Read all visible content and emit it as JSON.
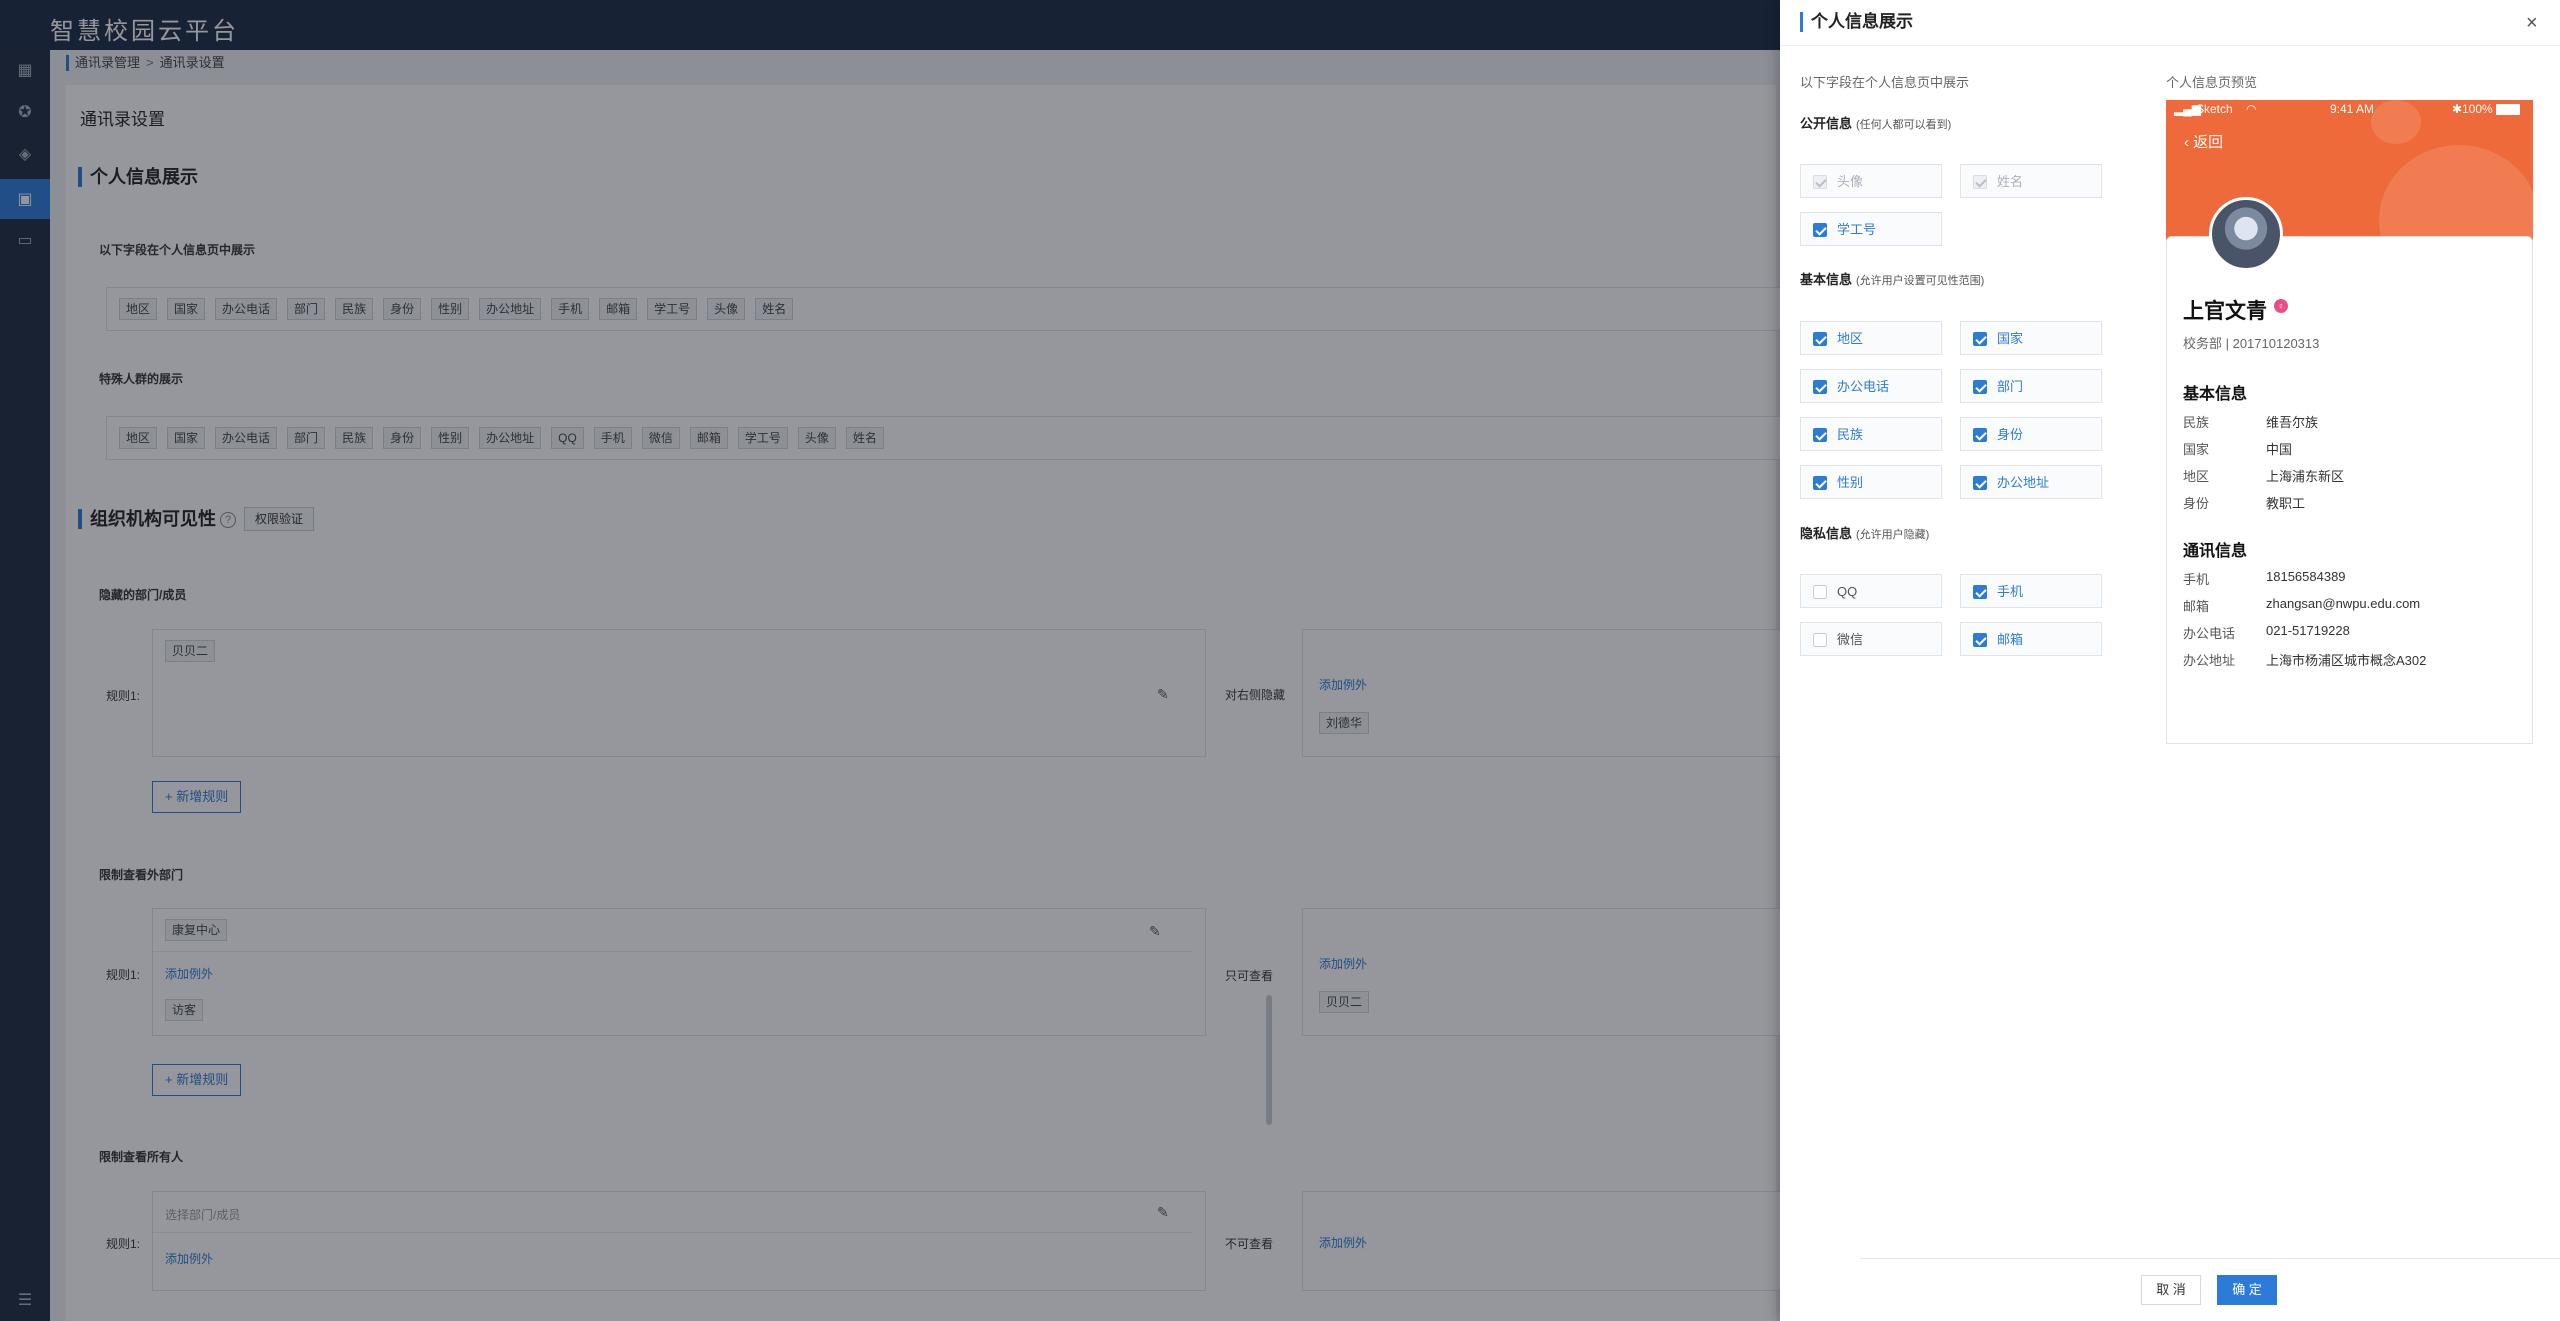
{
  "app": {
    "title": "智慧校园云平台"
  },
  "nav": {
    "icons": [
      "grid-icon",
      "star-icon",
      "layers-icon",
      "apps-icon",
      "message-icon"
    ],
    "bottom_icon": "menu-icon"
  },
  "breadcrumb": {
    "items": [
      "通讯录管理",
      "通讯录设置"
    ],
    "separator": ">"
  },
  "page": {
    "title": "通讯录设置",
    "section_profile": "个人信息展示",
    "profile_sub": "以下字段在个人信息页中展示",
    "profile_tags": [
      "地区",
      "国家",
      "办公电话",
      "部门",
      "民族",
      "身份",
      "性别",
      "办公地址",
      "手机",
      "邮箱",
      "学工号",
      "头像",
      "姓名"
    ],
    "special_sub": "特殊人群的展示",
    "special_tags": [
      "地区",
      "国家",
      "办公电话",
      "部门",
      "民族",
      "身份",
      "性别",
      "办公地址",
      "QQ",
      "手机",
      "微信",
      "邮箱",
      "学工号",
      "头像",
      "姓名"
    ],
    "section_org": "组织机构可见性",
    "org_help": "?",
    "perm_button": "权限验证",
    "hidden_sub": "隐藏的部门/成员",
    "rule_label": "规则1:",
    "hidden_rule_tag": "贝贝二",
    "hidden_side_label": "对右侧隐藏",
    "add_exception": "添加例外",
    "hidden_exception_tag": "刘德华",
    "add_rule": "+ 新增规则",
    "limit_outer_sub": "限制查看外部门",
    "limit_outer_tag": "康复中心",
    "limit_outer_exception_tag": "访客",
    "limit_outer_side_label": "只可查看",
    "limit_outer_side_tag": "贝贝二",
    "limit_all_sub": "限制查看所有人",
    "limit_all_placeholder": "选择部门/成员",
    "limit_all_side_label": "不可查看"
  },
  "drawer": {
    "title": "个人信息展示",
    "close": "×",
    "left_label": "以下字段在个人信息页中展示",
    "right_label": "个人信息页预览",
    "public_group": {
      "title": "公开信息",
      "hint": "(任何人都可以看到)"
    },
    "public_items": [
      {
        "label": "头像",
        "state": "disabled"
      },
      {
        "label": "姓名",
        "state": "disabled"
      },
      {
        "label": "学工号",
        "state": "checked"
      }
    ],
    "basic_group": {
      "title": "基本信息",
      "hint": "(允许用户设置可见性范围)"
    },
    "basic_items": [
      {
        "label": "地区",
        "state": "checked"
      },
      {
        "label": "国家",
        "state": "checked"
      },
      {
        "label": "办公电话",
        "state": "checked"
      },
      {
        "label": "部门",
        "state": "checked"
      },
      {
        "label": "民族",
        "state": "checked"
      },
      {
        "label": "身份",
        "state": "checked"
      },
      {
        "label": "性别",
        "state": "checked"
      },
      {
        "label": "办公地址",
        "state": "checked"
      }
    ],
    "private_group": {
      "title": "隐私信息",
      "hint": "(允许用户隐藏)"
    },
    "private_items": [
      {
        "label": "QQ",
        "state": "unchecked"
      },
      {
        "label": "手机",
        "state": "checked"
      },
      {
        "label": "微信",
        "state": "unchecked"
      },
      {
        "label": "邮箱",
        "state": "checked"
      }
    ],
    "cancel": "取 消",
    "ok": "确 定"
  },
  "preview": {
    "carrier": "Sketch",
    "time": "9:41 AM",
    "battery": "100%",
    "back": "返回",
    "name": "上官文青",
    "badge": "♀",
    "dept": "校务部 | 201710120313",
    "basic_title": "基本信息",
    "basic_rows": [
      {
        "k": "民族",
        "v": "维吾尔族"
      },
      {
        "k": "国家",
        "v": "中国"
      },
      {
        "k": "地区",
        "v": "上海浦东新区"
      },
      {
        "k": "身份",
        "v": "教职工"
      }
    ],
    "contact_title": "通讯信息",
    "contact_rows": [
      {
        "k": "手机",
        "v": "18156584389"
      },
      {
        "k": "邮箱",
        "v": "zhangsan@nwpu.edu.com"
      },
      {
        "k": "办公电话",
        "v": "021-51719228"
      },
      {
        "k": "办公地址",
        "v": "上海市杨浦区城市概念A302"
      }
    ]
  },
  "colors": {
    "accent": "#2d7bd8",
    "preview_header": "#ef6a3a",
    "topbar": "#1b2a44"
  }
}
